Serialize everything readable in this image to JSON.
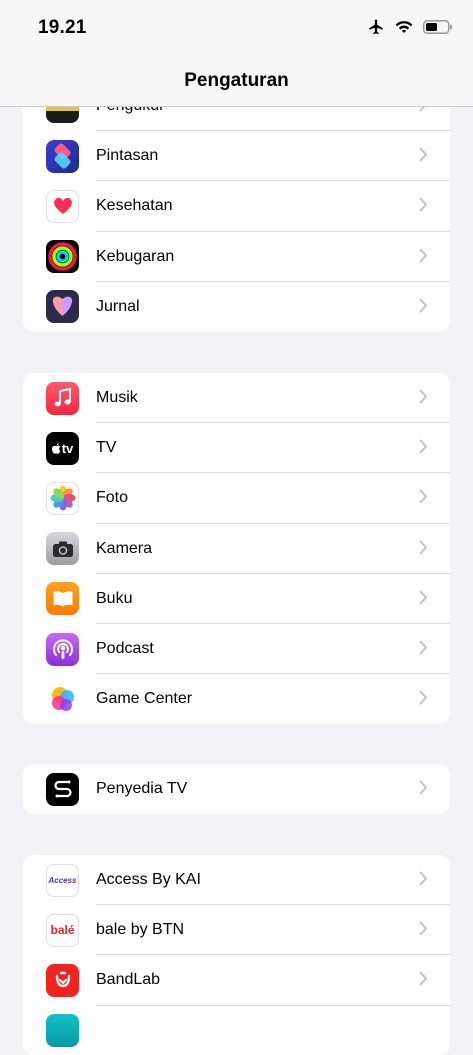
{
  "status": {
    "time": "19.21"
  },
  "nav": {
    "title": "Pengaturan"
  },
  "groups": [
    {
      "items": [
        {
          "label": "Pengukur",
          "icon": "measure-icon"
        },
        {
          "label": "Pintasan",
          "icon": "shortcuts-icon"
        },
        {
          "label": "Kesehatan",
          "icon": "health-icon"
        },
        {
          "label": "Kebugaran",
          "icon": "fitness-icon"
        },
        {
          "label": "Jurnal",
          "icon": "journal-icon"
        }
      ]
    },
    {
      "items": [
        {
          "label": "Musik",
          "icon": "music-icon"
        },
        {
          "label": "TV",
          "icon": "tv-icon",
          "icon_text": "tv"
        },
        {
          "label": "Foto",
          "icon": "photos-icon"
        },
        {
          "label": "Kamera",
          "icon": "camera-icon"
        },
        {
          "label": "Buku",
          "icon": "books-icon"
        },
        {
          "label": "Podcast",
          "icon": "podcast-icon"
        },
        {
          "label": "Game Center",
          "icon": "game-center-icon"
        }
      ]
    },
    {
      "items": [
        {
          "label": "Penyedia TV",
          "icon": "tv-provider-icon"
        }
      ]
    },
    {
      "items": [
        {
          "label": "Access By KAI",
          "icon": "access-by-kai-icon",
          "icon_text": "Access"
        },
        {
          "label": "bale by BTN",
          "icon": "bale-icon",
          "icon_text": "balé"
        },
        {
          "label": "BandLab",
          "icon": "bandlab-icon"
        },
        {
          "label": "",
          "icon": "app-icon"
        }
      ]
    }
  ],
  "colors": {
    "background": "#f2f2f7",
    "separator": "#dcdce0",
    "chevron": "#c4c4c7"
  }
}
